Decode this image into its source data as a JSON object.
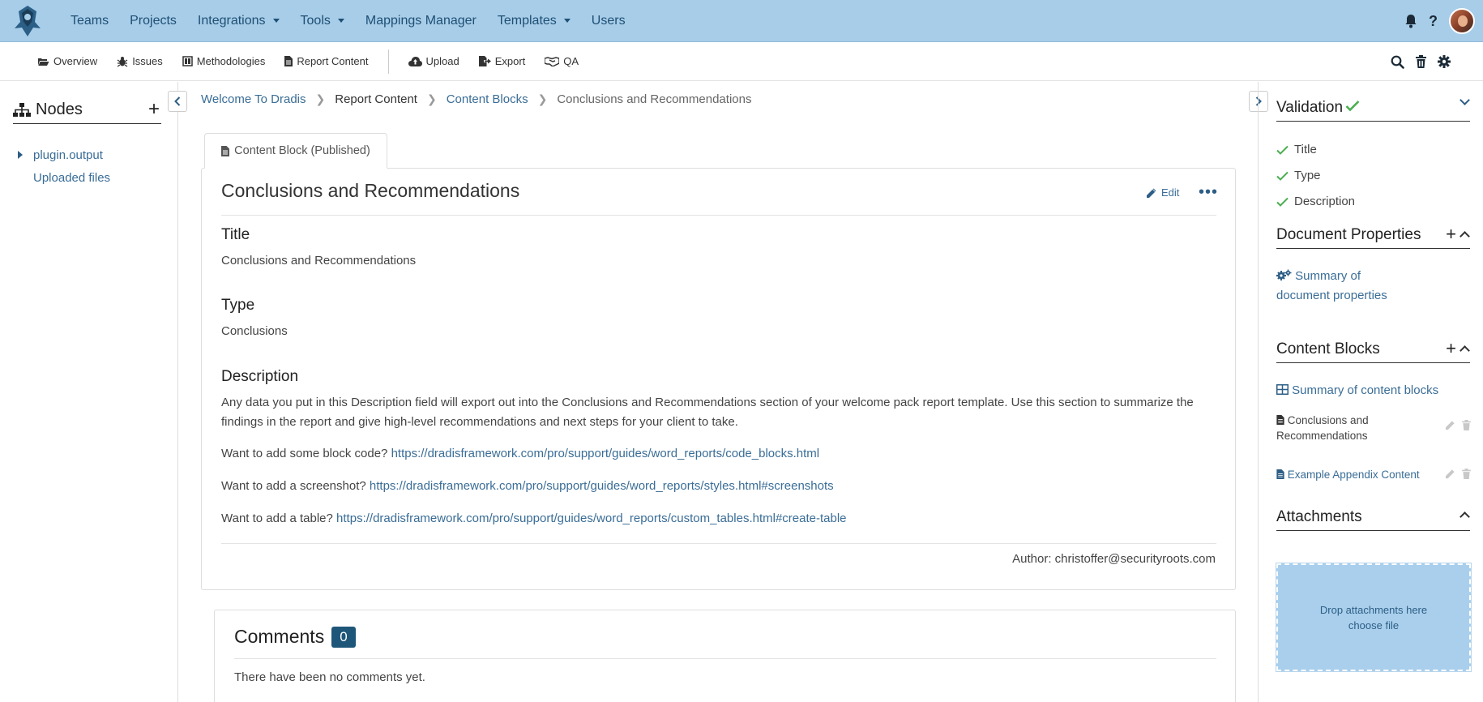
{
  "topnav": {
    "items": [
      {
        "label": "Teams",
        "dropdown": false
      },
      {
        "label": "Projects",
        "dropdown": false
      },
      {
        "label": "Integrations",
        "dropdown": true
      },
      {
        "label": "Tools",
        "dropdown": true
      },
      {
        "label": "Mappings Manager",
        "dropdown": false
      },
      {
        "label": "Templates",
        "dropdown": true
      },
      {
        "label": "Users",
        "dropdown": false
      }
    ],
    "help_label": "?"
  },
  "subnav": {
    "items": [
      {
        "label": "Overview",
        "icon": "folder-open-icon"
      },
      {
        "label": "Issues",
        "icon": "bug-icon"
      },
      {
        "label": "Methodologies",
        "icon": "book-icon"
      },
      {
        "label": "Report Content",
        "icon": "file-icon"
      },
      {
        "label": "Upload",
        "icon": "cloud-upload-icon"
      },
      {
        "label": "Export",
        "icon": "export-icon"
      },
      {
        "label": "QA",
        "icon": "handshake-icon"
      }
    ]
  },
  "left_sidebar": {
    "title": "Nodes",
    "add_label": "+",
    "nodes": [
      {
        "label": "plugin.output",
        "expandable": true
      },
      {
        "label": "Uploaded files",
        "expandable": false
      }
    ]
  },
  "breadcrumb": [
    "Welcome To Dradis",
    "Report Content",
    "Content Blocks",
    "Conclusions and Recommendations"
  ],
  "tab": {
    "label": "Content Block (Published)"
  },
  "content_block": {
    "title": "Conclusions and Recommendations",
    "edit_label": "Edit",
    "more_label": "•••",
    "fields": {
      "title_label": "Title",
      "title_value": "Conclusions and Recommendations",
      "type_label": "Type",
      "type_value": "Conclusions",
      "description_label": "Description",
      "description_text": "Any data you put in this Description field will export out into the Conclusions and Recommendations section of your welcome pack report template. Use this section to summarize the findings in the report and give high-level recommendations and next steps for your client to take.",
      "lines": [
        {
          "prefix": "Want to add some block code? ",
          "link": "https://dradisframework.com/pro/support/guides/word_reports/code_blocks.html"
        },
        {
          "prefix": "Want to add a screenshot? ",
          "link": "https://dradisframework.com/pro/support/guides/word_reports/styles.html#screenshots"
        },
        {
          "prefix": "Want to add a table? ",
          "link": "https://dradisframework.com/pro/support/guides/word_reports/custom_tables.html#create-table"
        }
      ]
    },
    "author": "Author: christoffer@securityroots.com"
  },
  "comments": {
    "title": "Comments",
    "count": "0",
    "empty_text": "There have been no comments yet."
  },
  "right_sidebar": {
    "validation": {
      "title": "Validation",
      "items": [
        "Title",
        "Type",
        "Description"
      ]
    },
    "document_properties": {
      "title": "Document Properties",
      "link_line1": "Summary of",
      "link_line2": "document properties"
    },
    "content_blocks": {
      "title": "Content Blocks",
      "summary_link": "Summary of content blocks",
      "items": [
        {
          "line1": "Conclusions and",
          "line2": "Recommendations"
        },
        {
          "line1": "Example Appendix Content",
          "line2": ""
        }
      ]
    },
    "attachments": {
      "title": "Attachments",
      "drop_text": "Drop attachments here",
      "choose_label": "choose file"
    }
  },
  "colors": {
    "navbar_bg": "#a7cde9",
    "link": "#3a6d96",
    "badge": "#1e5679",
    "success": "#4caf50",
    "dropzone": "#a9cfec"
  }
}
